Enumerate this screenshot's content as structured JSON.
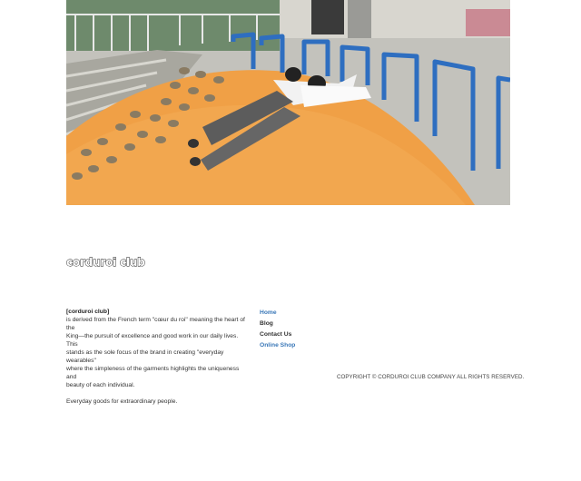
{
  "hero": {
    "image": "Photo of two people lying face down on an orange dome-shaped playground climbing structure with blue metal bars"
  },
  "brand": {
    "logo_text": "corduroi club"
  },
  "about": {
    "title": "[corduroi club]",
    "lines": [
      "is derived from the French term \"cœur du roi\" meaning the heart of the",
      "King—the pursuit of excellence and good work in our daily lives. This",
      "stands as the sole focus of the brand in creating \"everyday wearables\"",
      "where the simpleness of the garments highlights the uniqueness and",
      "beauty of each individual."
    ],
    "tagline": "Everyday goods for extraordinary people."
  },
  "nav": {
    "items": [
      {
        "label": "Home",
        "color": "#3a78b8"
      },
      {
        "label": "Blog",
        "color": "#333333"
      },
      {
        "label": "Contact Us",
        "color": "#333333"
      },
      {
        "label": "Online Shop",
        "color": "#3a78b8"
      }
    ]
  },
  "footer": {
    "copyright": "COPYRIGHT © CORDUROI CLUB COMPANY ALL RIGHTS RESERVED."
  },
  "colors": {
    "accent": "#3a78b8",
    "dome": "#f0a046",
    "bars": "#2e6ec0"
  }
}
